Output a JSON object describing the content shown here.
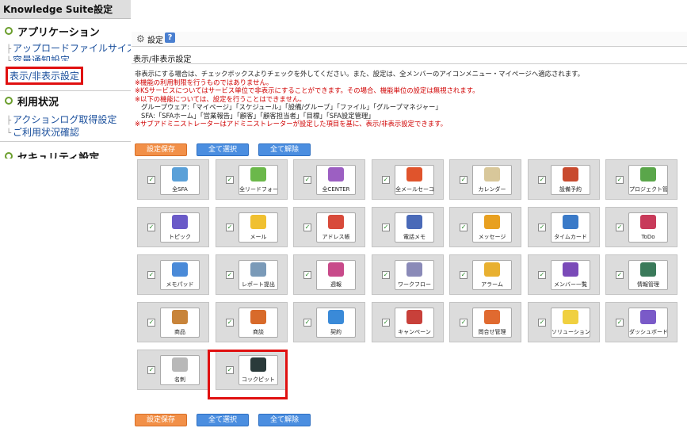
{
  "sidebar": {
    "header": "Knowledge Suite設定",
    "sections": [
      {
        "label": "アプリケーション",
        "items": [
          "アップロードファイルサイズ",
          "容量通知設定",
          "表示/非表示設定"
        ]
      },
      {
        "label": "利用状況",
        "items": [
          "アクションログ取得設定",
          "ご利用状況確認"
        ]
      },
      {
        "label": "セキュリティ設定",
        "items": []
      }
    ]
  },
  "main": {
    "toolbar_label": "設定",
    "help": "?",
    "title": "表示/非表示設定",
    "notes": [
      {
        "text": "非表示にする場合は、チェックボックスよりチェックを外してください。また、設定は、全メンバーのアイコンメニュー・マイページへ適応されます。",
        "red": false
      },
      {
        "text": "※機能の利用制限を行うものではありません。",
        "red": true
      },
      {
        "text": "※KSサービスについてはサービス単位で非表示にすることができます。その場合、機能単位の設定は無視されます。",
        "red": true
      },
      {
        "text": "※以下の機能については、設定を行うことはできません。",
        "red": true
      },
      {
        "text": "グループウェア:「マイページ」「スケジュール」「設備/グループ」「ファイル」「グループマネジャー」",
        "red": false
      },
      {
        "text": "SFA:「SFAホーム」「営業報告」「顧客」「顧客担当者」「目標」「SFA設定管理」",
        "red": false
      },
      {
        "text": "※サブアドミニストレーターはアドミニストレーターが設定した項目を基に、表示/非表示設定できます。",
        "red": true
      }
    ],
    "buttons": {
      "save": "設定保存",
      "select_all": "全て選択",
      "clear_all": "全て解除"
    },
    "check": "✓",
    "items": [
      {
        "label": "全SFA",
        "color": "#5aa0d8"
      },
      {
        "label": "全リードフォー",
        "color": "#6bb84a"
      },
      {
        "label": "全CENTER",
        "color": "#9c5fc2"
      },
      {
        "label": "全メールセーコン",
        "color": "#e0542c"
      },
      {
        "label": "カレンダー",
        "color": "#d8c79a"
      },
      {
        "label": "設備予約",
        "color": "#c84a2e"
      },
      {
        "label": "プロジェクト管理",
        "color": "#5aa64a"
      },
      {
        "label": "トピック",
        "color": "#6a5ac8"
      },
      {
        "label": "メール",
        "color": "#f0c030"
      },
      {
        "label": "アドレス帳",
        "color": "#d84a3a"
      },
      {
        "label": "電話メモ",
        "color": "#4a6ab8"
      },
      {
        "label": "メッセージ",
        "color": "#e8a020"
      },
      {
        "label": "タイムカード",
        "color": "#3a7ac8"
      },
      {
        "label": "ToDo",
        "color": "#c83a5a"
      },
      {
        "label": "メモパッド",
        "color": "#4a8ad8"
      },
      {
        "label": "レポート提出",
        "color": "#7a9ab8"
      },
      {
        "label": "週報",
        "color": "#c84a8a"
      },
      {
        "label": "ワークフロー",
        "color": "#8a8ab8"
      },
      {
        "label": "アラーム",
        "color": "#e8b030"
      },
      {
        "label": "メンバー一覧",
        "color": "#7a4ab8"
      },
      {
        "label": "情報管理",
        "color": "#3a7a5a"
      },
      {
        "label": "商品",
        "color": "#c8843a"
      },
      {
        "label": "商談",
        "color": "#d86a2a"
      },
      {
        "label": "契約",
        "color": "#3a8ad8"
      },
      {
        "label": "キャンペーン",
        "color": "#c8403a"
      },
      {
        "label": "問合せ管理",
        "color": "#e06a30"
      },
      {
        "label": "ソリューション",
        "color": "#f0d040"
      },
      {
        "label": "ダッシュボード",
        "color": "#7a5ac8"
      },
      {
        "label": "名刺",
        "color": "#b8b8b8"
      },
      {
        "label": "コックピット",
        "color": "#2a3a3a"
      }
    ]
  }
}
